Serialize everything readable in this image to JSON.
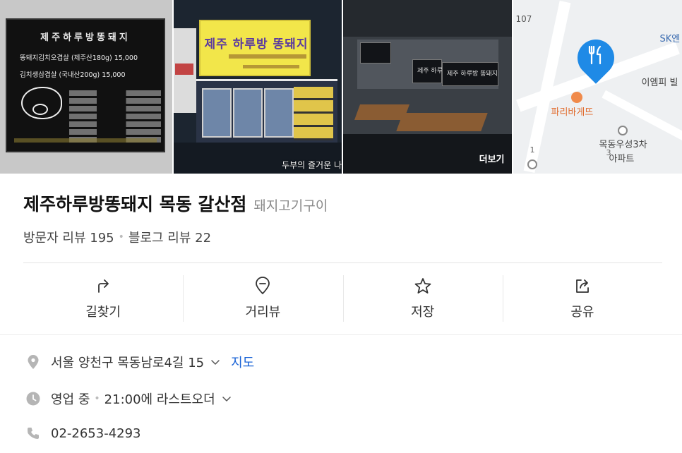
{
  "photos": {
    "menu_board": {
      "title": "제주하루방똥돼지",
      "line1": "똥돼지김치오겹살 (제주산180g) 15,000",
      "line2": "김치생삼겹살 (국내산200g) 15,000"
    },
    "storefront": {
      "sign_title": "제주 하루방 똥돼지",
      "caption": "두부의 즐거운 나"
    },
    "interior": {
      "screen_left": "제주 하루방",
      "screen_right": "제주 하루방 똥돼지",
      "more_label": "더보기"
    },
    "map": {
      "label_107": "107",
      "label_sk": "SK엔",
      "label_emp": "이엠피 빌",
      "label_bakery": "파리바게뜨",
      "label_apt": "목동우성3차",
      "label_apt2": "아파트",
      "label_1": "1",
      "label_3": "3"
    }
  },
  "place": {
    "name": "제주하루방똥돼지 목동 갈산점",
    "category": "돼지고기구이",
    "visitor_reviews": "방문자 리뷰 195",
    "blog_reviews": "블로그 리뷰 22"
  },
  "actions": [
    {
      "label": "길찾기"
    },
    {
      "label": "거리뷰"
    },
    {
      "label": "저장"
    },
    {
      "label": "공유"
    }
  ],
  "info": {
    "address": "서울 양천구 목동남로4길 15",
    "map_link": "지도",
    "hours_status": "영업 중",
    "hours_detail": "21:00에 라스트오더",
    "phone": "02-2653-4293"
  },
  "colors": {
    "link": "#1a63d6",
    "pin": "#1f8ae6",
    "brand_orange": "#e06a2c"
  }
}
